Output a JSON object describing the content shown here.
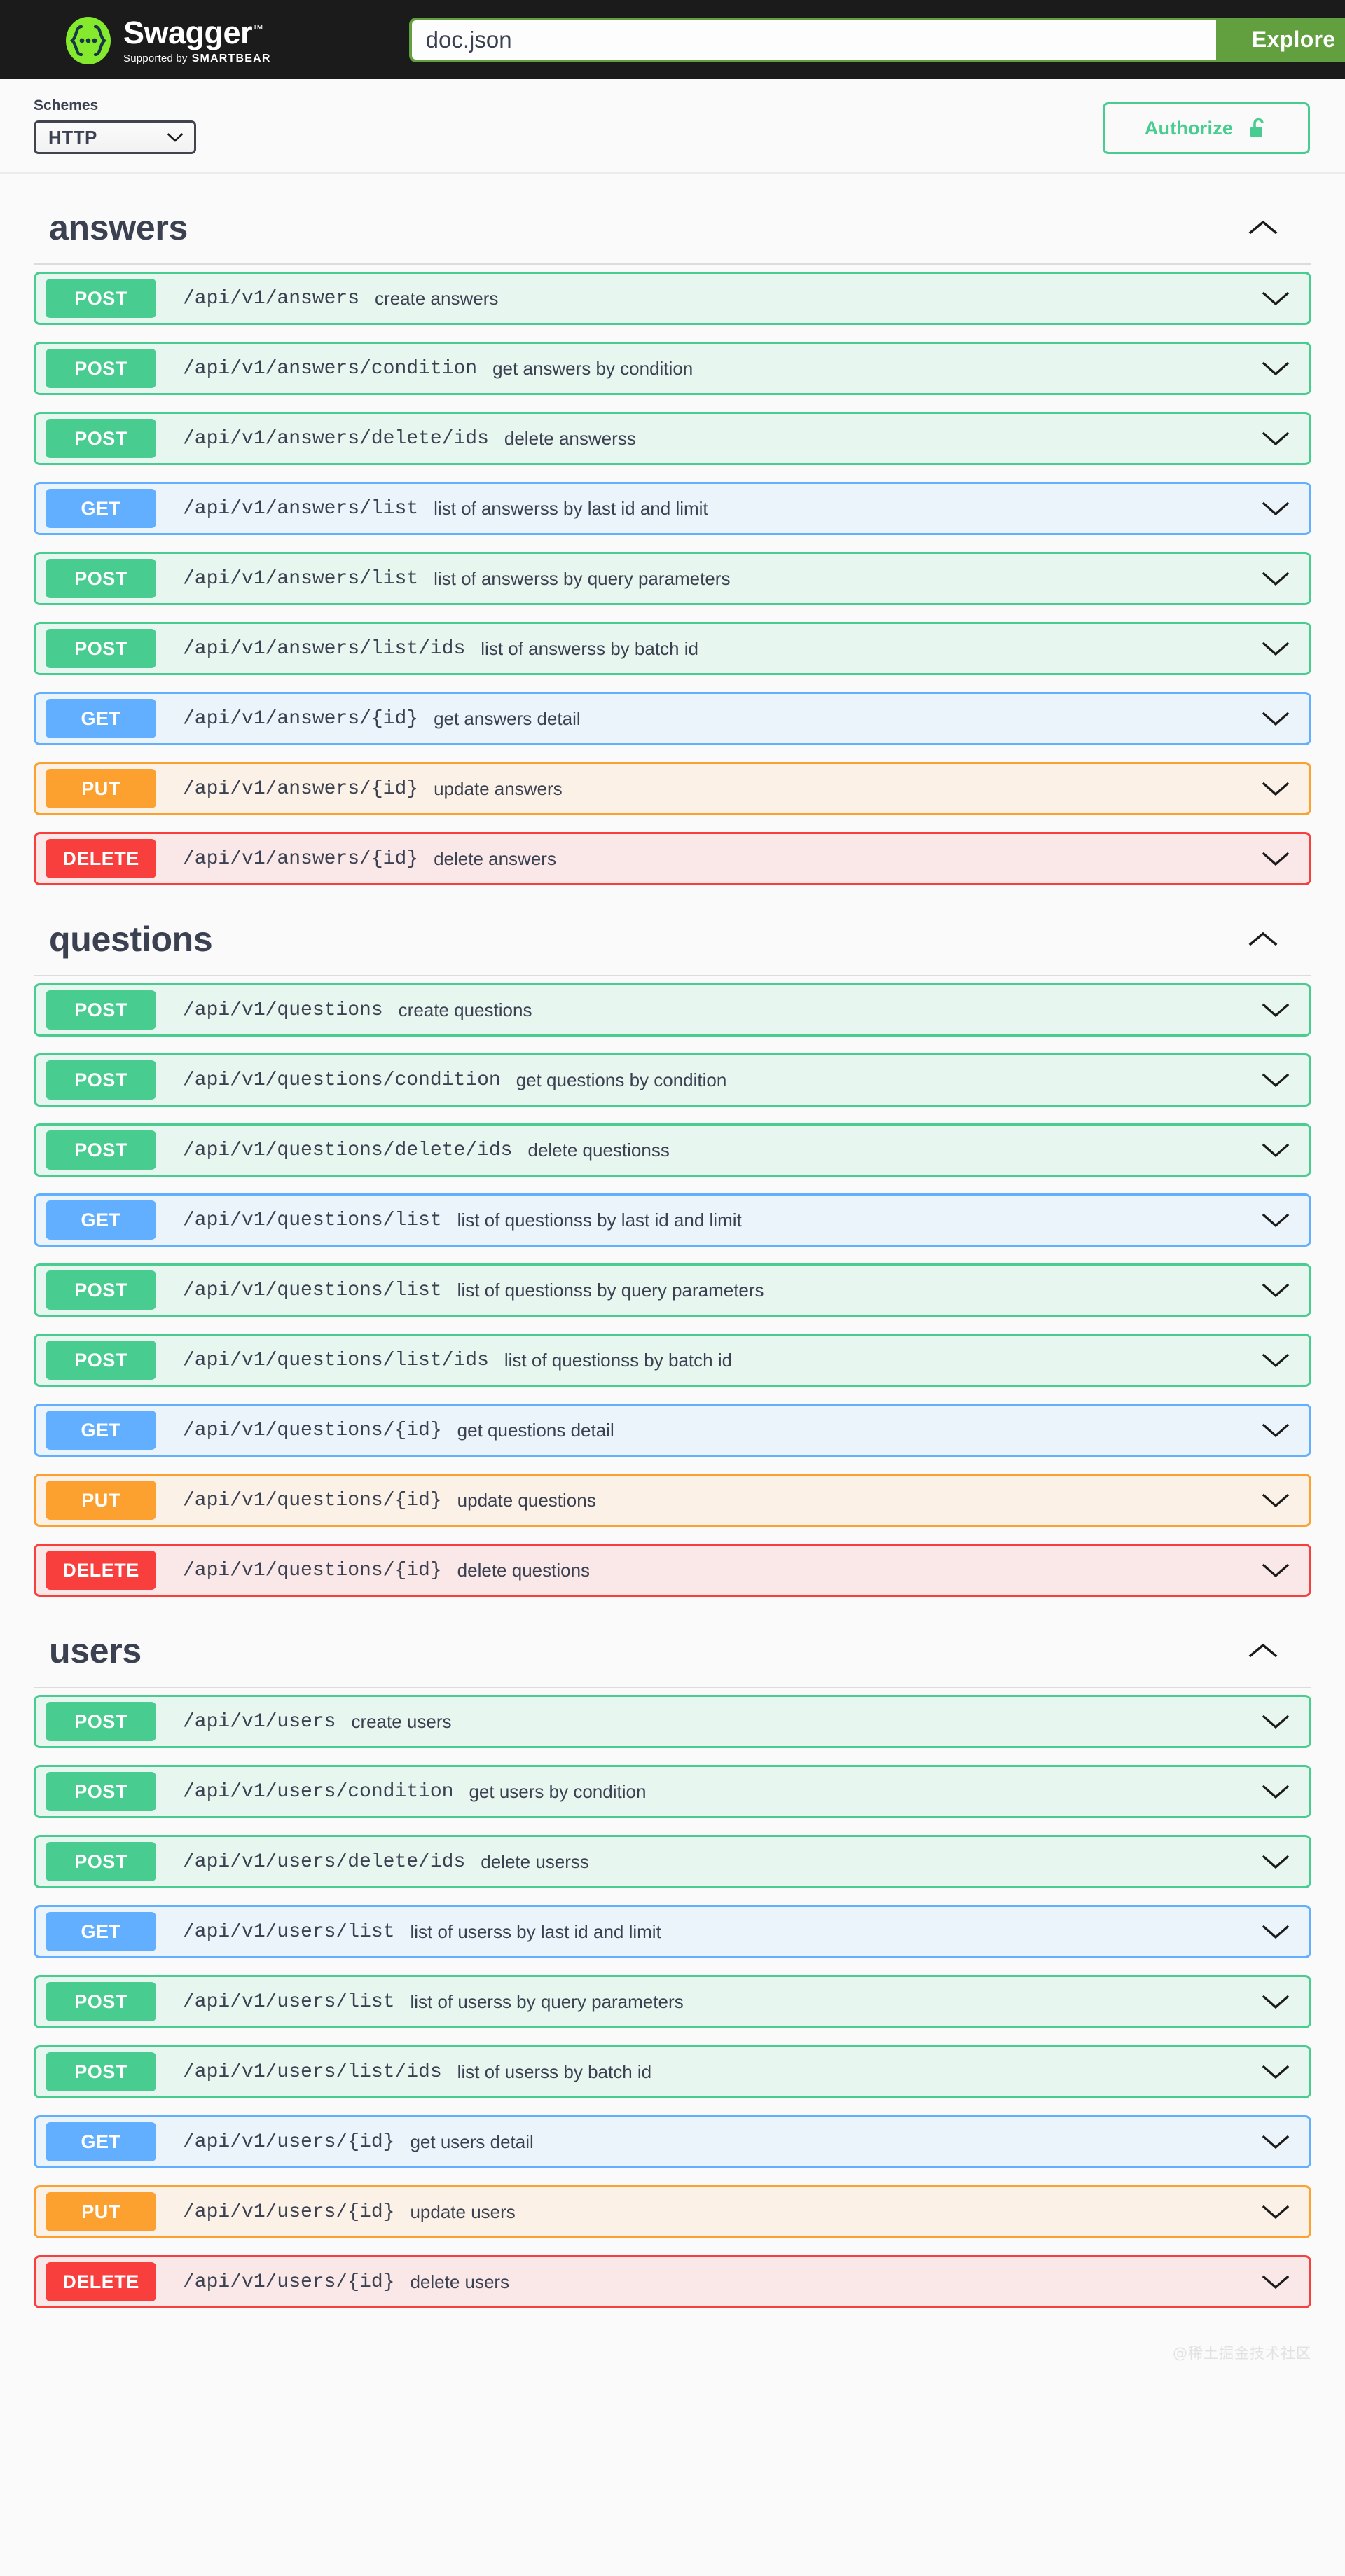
{
  "topbar": {
    "logo_title": "Swagger",
    "logo_tm": "™",
    "logo_supported_prefix": "Supported by",
    "logo_supported_brand": "SMARTBEAR",
    "url_value": "doc.json",
    "url_placeholder": "doc.json",
    "explore_label": "Explore"
  },
  "schemes": {
    "label": "Schemes",
    "selected": "HTTP",
    "options": [
      "HTTP"
    ]
  },
  "authorize": {
    "label": "Authorize",
    "icon": "unlock-icon",
    "color": "#49cc90"
  },
  "colors": {
    "post": "#49cc90",
    "get": "#61affe",
    "put": "#fca130",
    "delete": "#f93e3e",
    "explore": "#62a03f",
    "text": "#3b4151"
  },
  "watermark": "@稀土掘金技术社区",
  "tags": [
    {
      "name": "answers",
      "expanded": true,
      "toggle_icon": "chevron-up-icon",
      "operations": [
        {
          "method": "POST",
          "path": "/api/v1/answers",
          "summary": "create answers"
        },
        {
          "method": "POST",
          "path": "/api/v1/answers/condition",
          "summary": "get answers by condition"
        },
        {
          "method": "POST",
          "path": "/api/v1/answers/delete/ids",
          "summary": "delete answerss"
        },
        {
          "method": "GET",
          "path": "/api/v1/answers/list",
          "summary": "list of answerss by last id and limit"
        },
        {
          "method": "POST",
          "path": "/api/v1/answers/list",
          "summary": "list of answerss by query parameters"
        },
        {
          "method": "POST",
          "path": "/api/v1/answers/list/ids",
          "summary": "list of answerss by batch id"
        },
        {
          "method": "GET",
          "path": "/api/v1/answers/{id}",
          "summary": "get answers detail"
        },
        {
          "method": "PUT",
          "path": "/api/v1/answers/{id}",
          "summary": "update answers"
        },
        {
          "method": "DELETE",
          "path": "/api/v1/answers/{id}",
          "summary": "delete answers"
        }
      ]
    },
    {
      "name": "questions",
      "expanded": true,
      "toggle_icon": "chevron-up-icon",
      "operations": [
        {
          "method": "POST",
          "path": "/api/v1/questions",
          "summary": "create questions"
        },
        {
          "method": "POST",
          "path": "/api/v1/questions/condition",
          "summary": "get questions by condition"
        },
        {
          "method": "POST",
          "path": "/api/v1/questions/delete/ids",
          "summary": "delete questionss"
        },
        {
          "method": "GET",
          "path": "/api/v1/questions/list",
          "summary": "list of questionss by last id and limit"
        },
        {
          "method": "POST",
          "path": "/api/v1/questions/list",
          "summary": "list of questionss by query parameters"
        },
        {
          "method": "POST",
          "path": "/api/v1/questions/list/ids",
          "summary": "list of questionss by batch id"
        },
        {
          "method": "GET",
          "path": "/api/v1/questions/{id}",
          "summary": "get questions detail"
        },
        {
          "method": "PUT",
          "path": "/api/v1/questions/{id}",
          "summary": "update questions"
        },
        {
          "method": "DELETE",
          "path": "/api/v1/questions/{id}",
          "summary": "delete questions"
        }
      ]
    },
    {
      "name": "users",
      "expanded": true,
      "toggle_icon": "chevron-up-icon",
      "operations": [
        {
          "method": "POST",
          "path": "/api/v1/users",
          "summary": "create users"
        },
        {
          "method": "POST",
          "path": "/api/v1/users/condition",
          "summary": "get users by condition"
        },
        {
          "method": "POST",
          "path": "/api/v1/users/delete/ids",
          "summary": "delete userss"
        },
        {
          "method": "GET",
          "path": "/api/v1/users/list",
          "summary": "list of userss by last id and limit"
        },
        {
          "method": "POST",
          "path": "/api/v1/users/list",
          "summary": "list of userss by query parameters"
        },
        {
          "method": "POST",
          "path": "/api/v1/users/list/ids",
          "summary": "list of userss by batch id"
        },
        {
          "method": "GET",
          "path": "/api/v1/users/{id}",
          "summary": "get users detail"
        },
        {
          "method": "PUT",
          "path": "/api/v1/users/{id}",
          "summary": "update users"
        },
        {
          "method": "DELETE",
          "path": "/api/v1/users/{id}",
          "summary": "delete users"
        }
      ]
    }
  ]
}
